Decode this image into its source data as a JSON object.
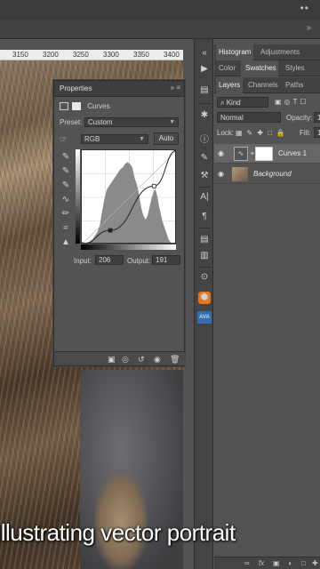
{
  "topbar": {
    "menu": "••",
    "scroll_arrows": "»"
  },
  "ruler": {
    "ticks": [
      "3150",
      "3200",
      "3250",
      "3300",
      "3350",
      "3400"
    ]
  },
  "properties": {
    "title": "Properties",
    "collapse": "»",
    "menu": "≡",
    "adjustment_name": "Curves",
    "preset_label": "Preset:",
    "preset_value": "Custom",
    "channel_value": "RGB",
    "auto_label": "Auto",
    "input_label": "Input:",
    "input_value": "206",
    "output_label": "Output:",
    "output_value": "191",
    "curve_points": [
      [
        0,
        0
      ],
      [
        30,
        15
      ],
      [
        76,
        62
      ],
      [
        100,
        100
      ]
    ],
    "histogram": [
      0,
      0,
      1,
      1,
      2,
      3,
      3,
      4,
      5,
      6,
      8,
      10,
      12,
      14,
      18,
      22,
      30,
      38,
      45,
      52,
      58,
      62,
      64,
      66,
      68,
      70,
      72,
      74,
      76,
      78,
      80,
      82,
      84,
      85,
      86,
      88,
      90,
      91,
      92,
      91,
      90,
      88,
      86,
      80,
      74,
      70,
      66,
      60,
      52,
      44,
      38,
      33,
      30,
      28,
      30,
      34,
      40,
      46,
      52,
      56,
      60,
      62,
      58,
      52,
      44,
      38,
      32,
      26,
      22,
      18,
      14,
      10,
      6,
      4,
      2,
      1,
      1,
      0,
      0,
      0
    ]
  },
  "right_tabs_1": {
    "histogram": "Histogram",
    "adjustments": "Adjustments"
  },
  "right_tabs_2": {
    "color": "Color",
    "swatches": "Swatches",
    "styles": "Styles"
  },
  "right_tabs_3": {
    "layers": "Layers",
    "channels": "Channels",
    "paths": "Paths"
  },
  "layers": {
    "kind_value": "Kind",
    "blend_value": "Normal",
    "opacity_label": "Opacity:",
    "opacity_value": "1",
    "lock_label": "Lock:",
    "fill_label": "Fill:",
    "fill_value": "1",
    "items": [
      {
        "name": "Curves 1"
      },
      {
        "name": "Background"
      }
    ]
  },
  "toolbar": {
    "ava": "AVA"
  },
  "caption": "Illustrating vector portrait"
}
